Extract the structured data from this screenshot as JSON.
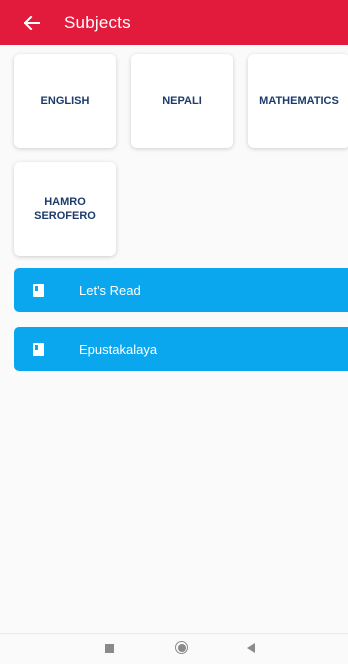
{
  "appbar": {
    "title": "Subjects",
    "back_icon": "arrow-left-icon",
    "color": "#e21a3b"
  },
  "subjects": [
    {
      "label": "ENGLISH"
    },
    {
      "label": "NEPALI"
    },
    {
      "label": "MATHEMATICS"
    },
    {
      "label": "HAMRO SEROFERO"
    }
  ],
  "links": [
    {
      "label": "Let's Read",
      "icon": "book-icon"
    },
    {
      "label": "Epustakalaya",
      "icon": "book-icon"
    }
  ],
  "colors": {
    "link_button": "#0aa7ef",
    "subject_text": "#1d3b6b"
  },
  "navbar": {
    "recents_icon": "square-icon",
    "home_icon": "circle-icon",
    "back_icon": "triangle-back-icon"
  }
}
